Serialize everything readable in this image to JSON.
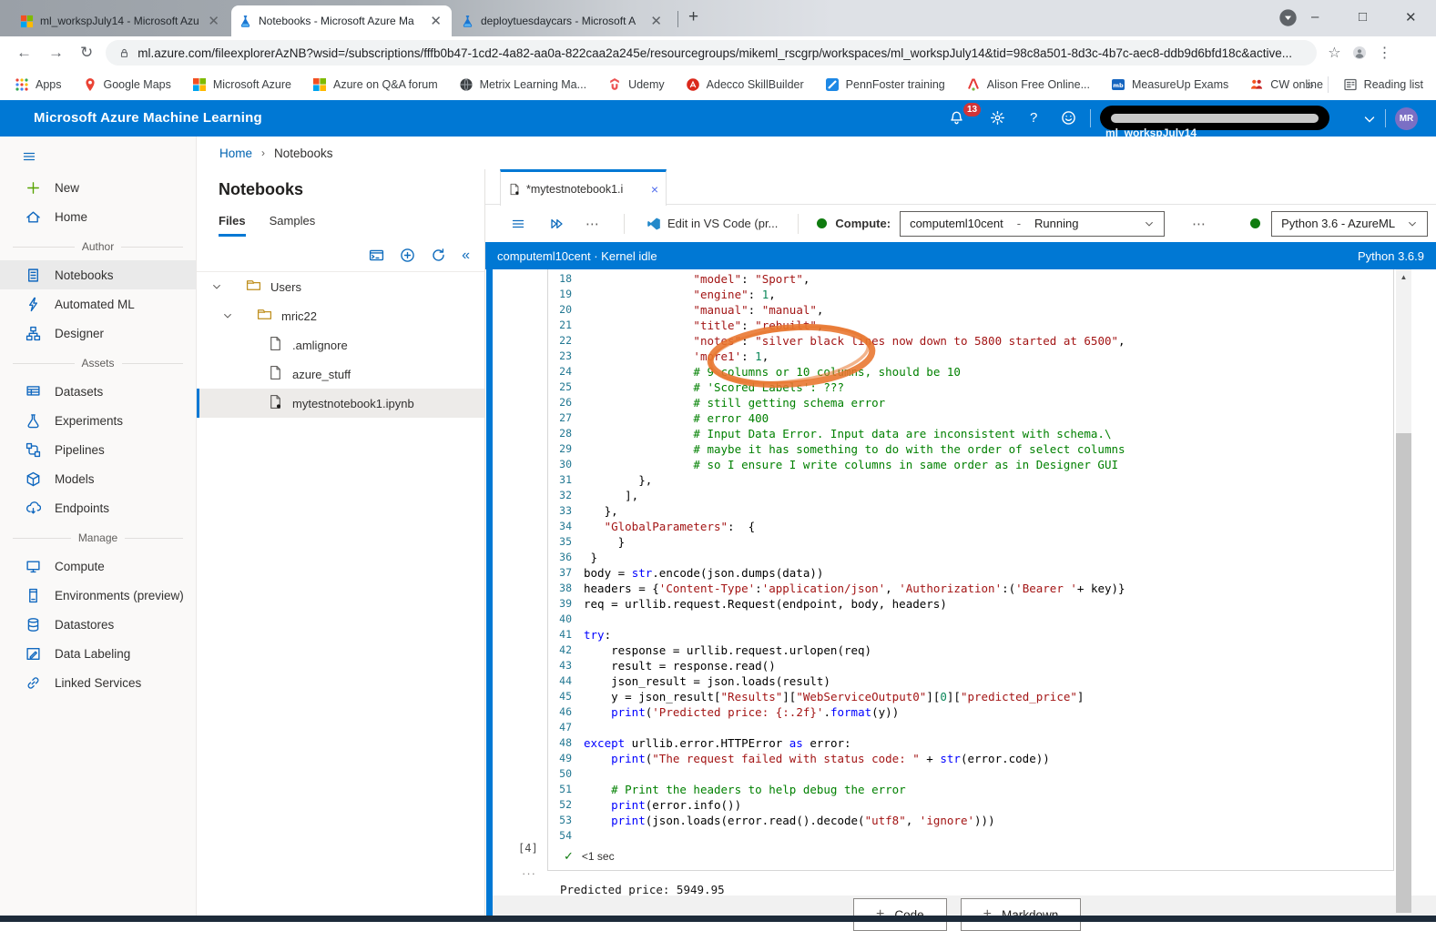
{
  "browser": {
    "window_controls": {
      "minimize": "–",
      "maximize": "□",
      "close": "✕"
    },
    "new_tab": "+",
    "tabs": [
      {
        "title": "ml_workspJuly14 - Microsoft Azu",
        "favicon": "microsoft-logo",
        "active": false
      },
      {
        "title": "Notebooks - Microsoft Azure Ma",
        "favicon": "azureml-flask",
        "active": true
      },
      {
        "title": "deploytuesdaycars - Microsoft A",
        "favicon": "azureml-flask",
        "active": false
      }
    ],
    "nav": {
      "back": "←",
      "forward": "→",
      "reload": "↻",
      "star": "☆",
      "kebab": "⋮"
    },
    "url": "ml.azure.com/fileexplorerAzNB?wsid=/subscriptions/fffb0b47-1cd2-4a82-aa0a-822caa2a245e/resourcegroups/mikeml_rscgrp/workspaces/ml_workspJuly14&tid=98c8a501-8d3c-4b7c-aec8-ddb9d6bfd18c&active...",
    "bookmarks": [
      {
        "label": "Apps",
        "icon": "apps-grid"
      },
      {
        "label": "Google Maps",
        "icon": "maps-pin"
      },
      {
        "label": "Microsoft Azure",
        "icon": "microsoft-logo"
      },
      {
        "label": "Azure on Q&A forum",
        "icon": "microsoft-logo"
      },
      {
        "label": "Metrix Learning Ma...",
        "icon": "globe-dark"
      },
      {
        "label": "Udemy",
        "icon": "udemy"
      },
      {
        "label": "Adecco SkillBuilder",
        "icon": "adecco"
      },
      {
        "label": "PennFoster training",
        "icon": "pennfoster"
      },
      {
        "label": "Alison Free Online...",
        "icon": "alison"
      },
      {
        "label": "MeasureUp Exams",
        "icon": "measureup"
      },
      {
        "label": "CW online",
        "icon": "cw"
      }
    ],
    "bookmarks_overflow": "»",
    "reading_list": "Reading list"
  },
  "app_header": {
    "title": "Microsoft Azure Machine Learning",
    "notification_count": "13",
    "help_glyph": "?",
    "workspace_peek": "ml_workspJuly14",
    "avatar_initials": "MR"
  },
  "breadcrumb": {
    "home": "Home",
    "separator": "›",
    "current": "Notebooks"
  },
  "sidebar": {
    "groups": [
      {
        "header": null,
        "items": [
          {
            "icon": "plus",
            "label": "New",
            "green": true
          },
          {
            "icon": "home",
            "label": "Home"
          }
        ]
      },
      {
        "header": "Author",
        "items": [
          {
            "icon": "notebook",
            "label": "Notebooks",
            "selected": true
          },
          {
            "icon": "automl",
            "label": "Automated ML"
          },
          {
            "icon": "designer",
            "label": "Designer"
          }
        ]
      },
      {
        "header": "Assets",
        "items": [
          {
            "icon": "datasets",
            "label": "Datasets"
          },
          {
            "icon": "flask",
            "label": "Experiments"
          },
          {
            "icon": "pipelines",
            "label": "Pipelines"
          },
          {
            "icon": "cube",
            "label": "Models"
          },
          {
            "icon": "endpoints",
            "label": "Endpoints"
          }
        ]
      },
      {
        "header": "Manage",
        "items": [
          {
            "icon": "compute",
            "label": "Compute"
          },
          {
            "icon": "environments",
            "label": "Environments (preview)"
          },
          {
            "icon": "datastore",
            "label": "Datastores"
          },
          {
            "icon": "labeling",
            "label": "Data Labeling"
          },
          {
            "icon": "linked",
            "label": "Linked Services"
          }
        ]
      }
    ]
  },
  "files_panel": {
    "title": "Notebooks",
    "tabs": [
      {
        "label": "Files"
      },
      {
        "label": "Samples"
      }
    ],
    "collapse_glyph": "«",
    "tree": [
      {
        "depth": 0,
        "type": "folder",
        "chevron": true,
        "label": "Users",
        "selected": false
      },
      {
        "depth": 1,
        "type": "folder",
        "chevron": true,
        "label": "mric22",
        "selected": false
      },
      {
        "depth": 2,
        "type": "file",
        "chevron": false,
        "label": ".amlignore",
        "selected": false
      },
      {
        "depth": 2,
        "type": "file",
        "chevron": false,
        "label": "azure_stuff",
        "selected": false
      },
      {
        "depth": 2,
        "type": "file-modified",
        "chevron": false,
        "label": "mytestnotebook1.ipynb",
        "selected": true
      }
    ]
  },
  "notebook": {
    "doc_tab": {
      "label": "*mytestnotebook1.i",
      "close": "×"
    },
    "toolbar": {
      "more": "⋯",
      "vscode_label": "Edit in VS Code (pr...",
      "compute_label": "Compute:",
      "compute_name": "computeml10cent",
      "compute_sep": "-",
      "compute_status": "Running",
      "kernel_name": "Python 3.6 - AzureML"
    },
    "kernel_bar": {
      "left": "computeml10cent · Kernel idle",
      "right": "Python 3.6.9"
    },
    "cell": {
      "execution_count": "[4]",
      "status_check": "✓",
      "duration": "<1 sec",
      "output_more": "···"
    },
    "output": "Predicted price: 5949.95",
    "add_plus": "+",
    "add_buttons": [
      {
        "label": "Code"
      },
      {
        "label": "Markdown"
      }
    ],
    "scroll_up_glyph": "▲",
    "annotation_color": "#e8742c",
    "code_lines": [
      {
        "n": 18,
        "parts": [
          [
            "p",
            "                "
          ],
          [
            "s",
            "\"model\""
          ],
          [
            "p",
            ": "
          ],
          [
            "s",
            "\"Sport\""
          ],
          [
            "p",
            ","
          ]
        ]
      },
      {
        "n": 19,
        "parts": [
          [
            "p",
            "                "
          ],
          [
            "s",
            "\"engine\""
          ],
          [
            "p",
            ": "
          ],
          [
            "n",
            "1"
          ],
          [
            "p",
            ","
          ]
        ]
      },
      {
        "n": 20,
        "parts": [
          [
            "p",
            "                "
          ],
          [
            "s",
            "\"manual\""
          ],
          [
            "p",
            ": "
          ],
          [
            "s",
            "\"manual\""
          ],
          [
            "p",
            ","
          ]
        ]
      },
      {
        "n": 21,
        "parts": [
          [
            "p",
            "                "
          ],
          [
            "s",
            "\"title\""
          ],
          [
            "p",
            ": "
          ],
          [
            "s",
            "\"rebuilt\""
          ],
          [
            "p",
            ","
          ]
        ]
      },
      {
        "n": 22,
        "parts": [
          [
            "p",
            "                "
          ],
          [
            "s",
            "\"notes\""
          ],
          [
            "p",
            ": "
          ],
          [
            "s",
            "\"silver black lines now down to 5800 started at 6500\""
          ],
          [
            "p",
            ","
          ]
        ]
      },
      {
        "n": 23,
        "parts": [
          [
            "p",
            "                "
          ],
          [
            "s",
            "'more1'"
          ],
          [
            "p",
            ": "
          ],
          [
            "n",
            "1"
          ],
          [
            "p",
            ","
          ]
        ]
      },
      {
        "n": 24,
        "parts": [
          [
            "p",
            "                "
          ],
          [
            "c",
            "# 9 columns or 10 columns, should be 10"
          ]
        ]
      },
      {
        "n": 25,
        "parts": [
          [
            "p",
            "                "
          ],
          [
            "c",
            "# 'Scored Labels': ???"
          ]
        ]
      },
      {
        "n": 26,
        "parts": [
          [
            "p",
            "                "
          ],
          [
            "c",
            "# still getting schema error"
          ]
        ]
      },
      {
        "n": 27,
        "parts": [
          [
            "p",
            "                "
          ],
          [
            "c",
            "# error 400"
          ]
        ]
      },
      {
        "n": 28,
        "parts": [
          [
            "p",
            "                "
          ],
          [
            "c",
            "# Input Data Error. Input data are inconsistent with schema.\\"
          ]
        ]
      },
      {
        "n": 29,
        "parts": [
          [
            "p",
            "                "
          ],
          [
            "c",
            "# maybe it has something to do with the order of select columns"
          ]
        ]
      },
      {
        "n": 30,
        "parts": [
          [
            "p",
            "                "
          ],
          [
            "c",
            "# so I ensure I write columns in same order as in Designer GUI"
          ]
        ]
      },
      {
        "n": 31,
        "parts": [
          [
            "p",
            "        },"
          ]
        ]
      },
      {
        "n": 32,
        "parts": [
          [
            "p",
            "      ],"
          ]
        ]
      },
      {
        "n": 33,
        "parts": [
          [
            "p",
            "   },"
          ]
        ]
      },
      {
        "n": 34,
        "parts": [
          [
            "p",
            "   "
          ],
          [
            "s",
            "\"GlobalParameters\""
          ],
          [
            "p",
            ":  {"
          ]
        ]
      },
      {
        "n": 35,
        "parts": [
          [
            "p",
            "     }"
          ]
        ]
      },
      {
        "n": 36,
        "parts": [
          [
            "p",
            " }"
          ]
        ]
      },
      {
        "n": 37,
        "parts": [
          [
            "p",
            "body = "
          ],
          [
            "k",
            "str"
          ],
          [
            "p",
            ".encode(json.dumps(data))"
          ]
        ]
      },
      {
        "n": 38,
        "parts": [
          [
            "p",
            "headers = {"
          ],
          [
            "s",
            "'Content-Type'"
          ],
          [
            "p",
            ":"
          ],
          [
            "s",
            "'application/json'"
          ],
          [
            "p",
            ", "
          ],
          [
            "s",
            "'Authorization'"
          ],
          [
            "p",
            ":("
          ],
          [
            "s",
            "'Bearer '"
          ],
          [
            "p",
            "+ key)}"
          ]
        ]
      },
      {
        "n": 39,
        "parts": [
          [
            "p",
            "req = urllib.request.Request(endpoint, body, headers)"
          ]
        ]
      },
      {
        "n": 40,
        "parts": []
      },
      {
        "n": 41,
        "parts": [
          [
            "k",
            "try"
          ],
          [
            "p",
            ":"
          ]
        ]
      },
      {
        "n": 42,
        "parts": [
          [
            "p",
            "    response = urllib.request.urlopen(req)"
          ]
        ]
      },
      {
        "n": 43,
        "parts": [
          [
            "p",
            "    result = response.read()"
          ]
        ]
      },
      {
        "n": 44,
        "parts": [
          [
            "p",
            "    json_result = json.loads(result)"
          ]
        ]
      },
      {
        "n": 45,
        "parts": [
          [
            "p",
            "    y = json_result["
          ],
          [
            "s",
            "\"Results\""
          ],
          [
            "p",
            "]["
          ],
          [
            "s",
            "\"WebServiceOutput0\""
          ],
          [
            "p",
            "]["
          ],
          [
            "n",
            "0"
          ],
          [
            "p",
            "]["
          ],
          [
            "s",
            "\"predicted_price\""
          ],
          [
            "p",
            "]"
          ]
        ]
      },
      {
        "n": 46,
        "parts": [
          [
            "p",
            "    "
          ],
          [
            "k",
            "print"
          ],
          [
            "p",
            "("
          ],
          [
            "s",
            "'Predicted price: {:.2f}'"
          ],
          [
            "p",
            "."
          ],
          [
            "k",
            "format"
          ],
          [
            "p",
            "(y))"
          ]
        ]
      },
      {
        "n": 47,
        "parts": []
      },
      {
        "n": 48,
        "parts": [
          [
            "k",
            "except"
          ],
          [
            "p",
            " urllib.error.HTTPError "
          ],
          [
            "k",
            "as"
          ],
          [
            "p",
            " error:"
          ]
        ]
      },
      {
        "n": 49,
        "parts": [
          [
            "p",
            "    "
          ],
          [
            "k",
            "print"
          ],
          [
            "p",
            "("
          ],
          [
            "s",
            "\"The request failed with status code: \""
          ],
          [
            "p",
            " + "
          ],
          [
            "k",
            "str"
          ],
          [
            "p",
            "(error.code))"
          ]
        ]
      },
      {
        "n": 50,
        "parts": []
      },
      {
        "n": 51,
        "parts": [
          [
            "p",
            "    "
          ],
          [
            "c",
            "# Print the headers to help debug the error"
          ]
        ]
      },
      {
        "n": 52,
        "parts": [
          [
            "p",
            "    "
          ],
          [
            "k",
            "print"
          ],
          [
            "p",
            "(error.info())"
          ]
        ]
      },
      {
        "n": 53,
        "parts": [
          [
            "p",
            "    "
          ],
          [
            "k",
            "print"
          ],
          [
            "p",
            "(json.loads(error.read().decode("
          ],
          [
            "s",
            "\"utf8\""
          ],
          [
            "p",
            ", "
          ],
          [
            "s",
            "'ignore'"
          ],
          [
            "p",
            ")))"
          ]
        ]
      },
      {
        "n": 54,
        "parts": []
      }
    ]
  },
  "colors": {
    "accent": "#0078d4",
    "annotation": "#e8742c",
    "running_green": "#107c10",
    "badge_red": "#d13438"
  }
}
